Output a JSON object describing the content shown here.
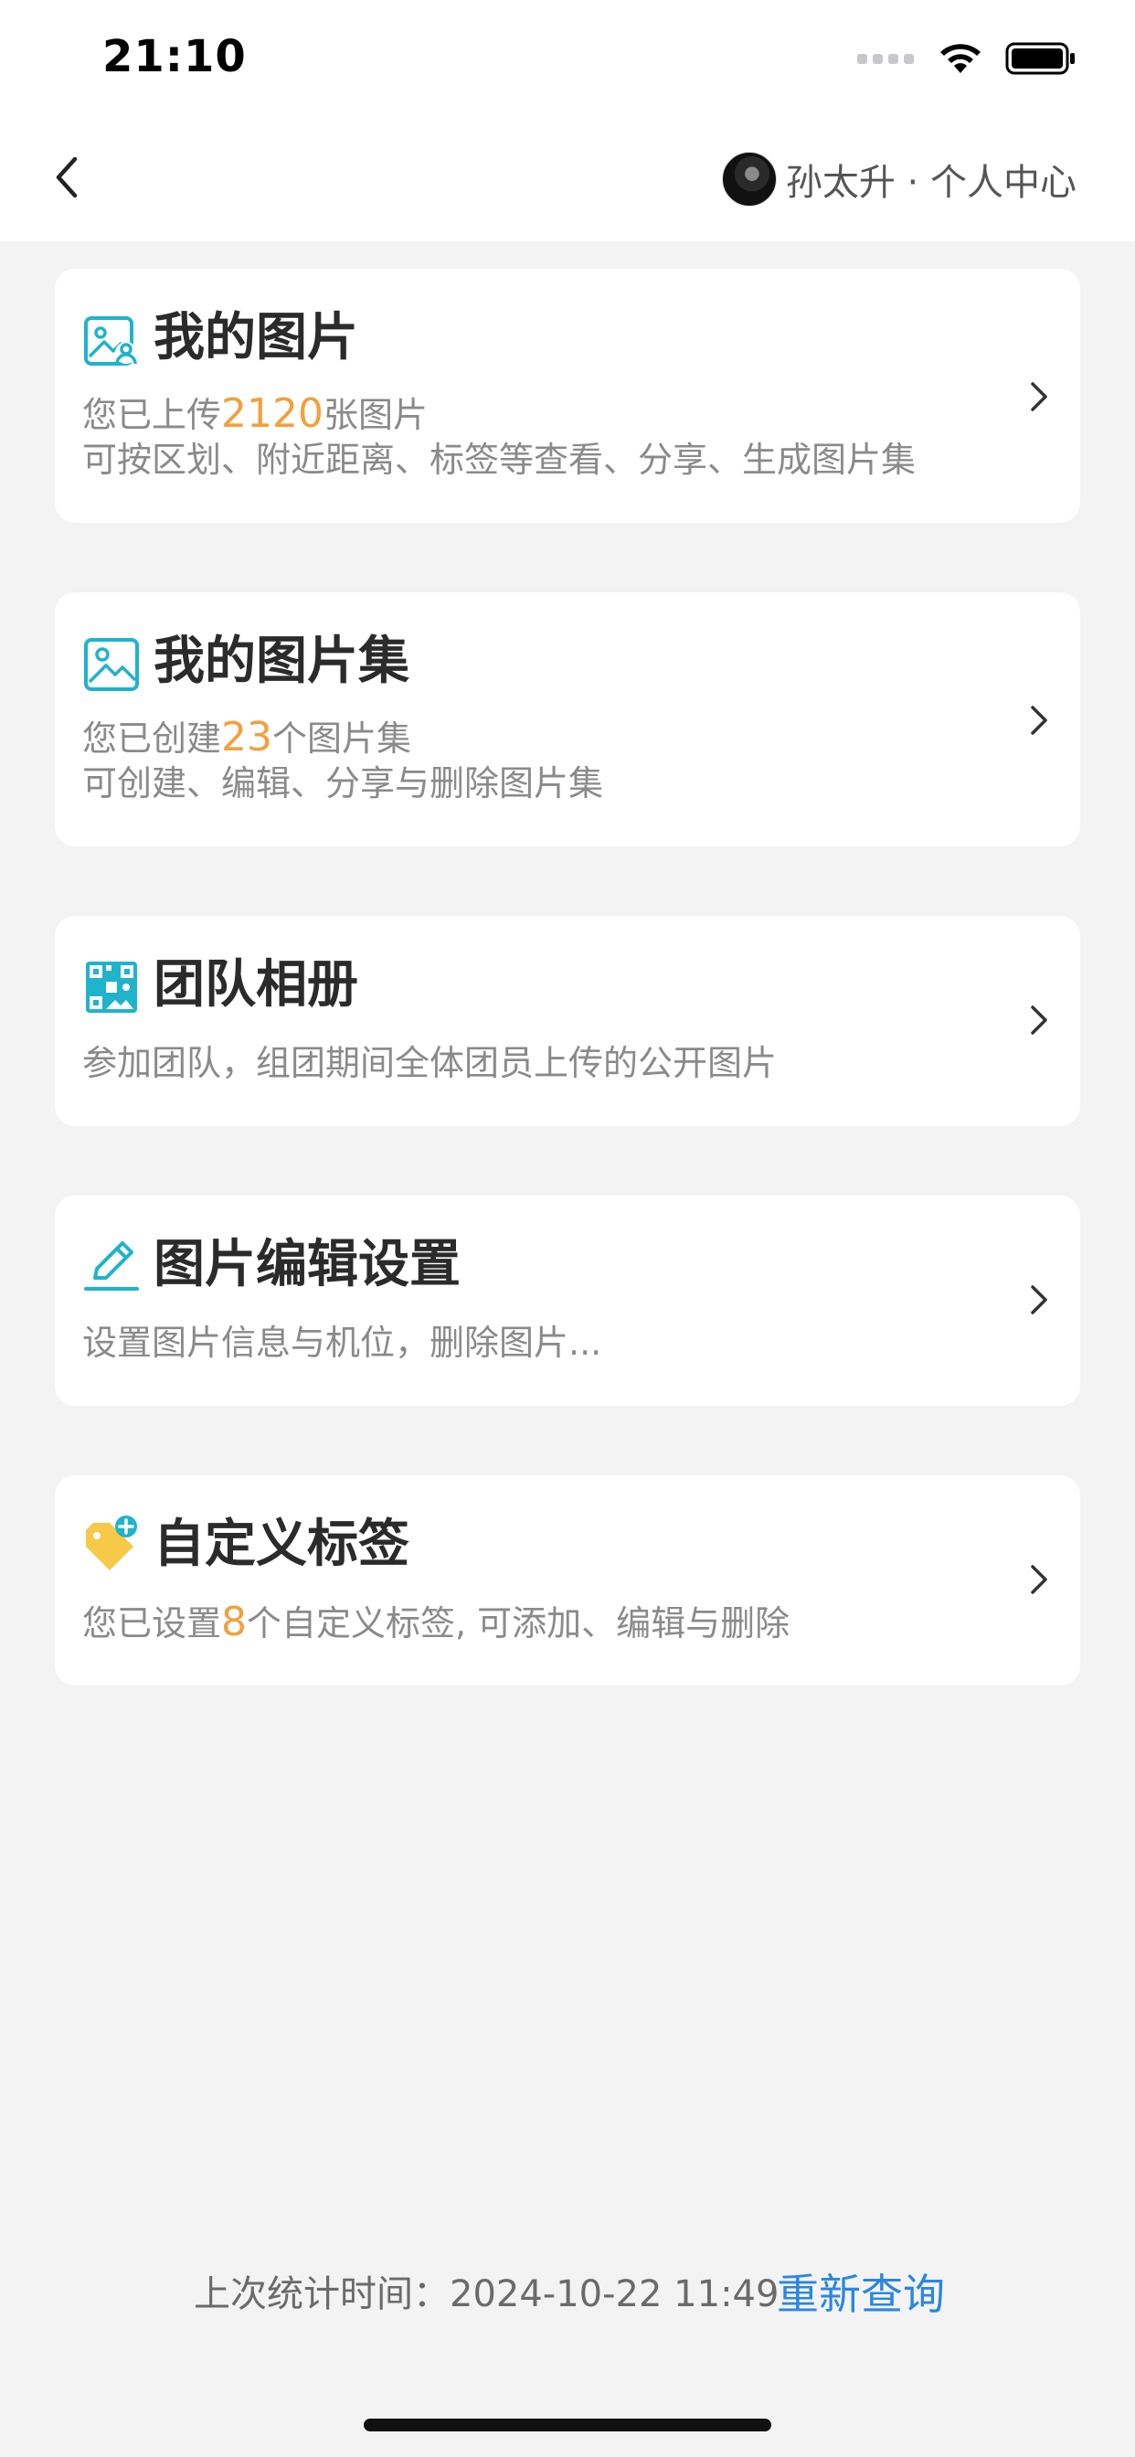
{
  "status_bar": {
    "time": "21:10"
  },
  "nav": {
    "profile_name": "孙太升 · 个人中心"
  },
  "cards": [
    {
      "icon": "image-user-icon",
      "title": "我的图片",
      "line1_prefix": "您已上传",
      "line1_value": "2120",
      "line1_suffix": "张图片",
      "line2": "可按区划、附近距离、标签等查看、分享、生成图片集"
    },
    {
      "icon": "image-collection-icon",
      "title": "我的图片集",
      "line1_prefix": "您已创建",
      "line1_value": "23",
      "line1_suffix": "个图片集",
      "line2": "可创建、编辑、分享与删除图片集"
    },
    {
      "icon": "team-album-icon",
      "title": "团队相册",
      "line1": "参加团队，组团期间全体团员上传的公开图片"
    },
    {
      "icon": "pencil-icon",
      "title": "图片编辑设置",
      "line1": "设置图片信息与机位，删除图片..."
    },
    {
      "icon": "tag-add-icon",
      "title": "自定义标签",
      "line1_prefix": "您已设置",
      "line1_value": "8",
      "line1_suffix": "个自定义标签, 可添加、编辑与删除"
    }
  ],
  "footer": {
    "stat_text": "上次统计时间：2024-10-22 11:49",
    "requery_label": "重新查询"
  },
  "colors": {
    "accent_orange": "#f3a03c",
    "link_blue": "#2b86e0",
    "icon_cyan": "#1fb3cc",
    "tag_yellow": "#f7c948"
  }
}
